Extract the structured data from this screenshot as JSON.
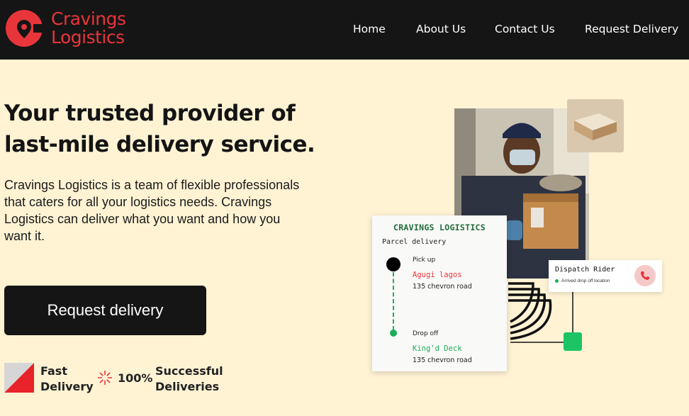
{
  "brand": {
    "line1": "Cravings",
    "line2": "Logistics",
    "color": "#e8353a"
  },
  "nav": {
    "home": "Home",
    "about": "About Us",
    "contact": "Contact Us",
    "request": "Request Delivery"
  },
  "hero": {
    "title": "Your trusted provider of last-mile delivery service.",
    "description": "Cravings Logistics is a team of flexible professionals that caters for all your logistics needs. Cravings Logistics can deliver what you want and how you want it.",
    "cta": "Request delivery"
  },
  "badges": {
    "fast_line1": "Fast",
    "fast_line2": "Delivery",
    "percent": "100%",
    "success_line1": "Successful",
    "success_line2": "Deliveries"
  },
  "card": {
    "brand": "CRAVINGS LOGISTICS",
    "type": "Parcel delivery",
    "pickup_label": "Pick up",
    "pickup_place": "Agugi lagos",
    "pickup_address": "135 chevron road",
    "dropoff_label": "Drop off",
    "dropoff_place": "King'd Deck",
    "dropoff_address": "135 chevron road"
  },
  "rider": {
    "title": "Dispatch Rider",
    "status": "Arrived drop off location"
  },
  "colors": {
    "accent": "#e8353a",
    "green": "#1cae5a",
    "dark": "#151515",
    "background": "#fff3d4"
  },
  "icons": {
    "logo": "location-pin-icon",
    "burst": "starburst-icon",
    "phone": "phone-icon",
    "flag": "flag-icon"
  }
}
